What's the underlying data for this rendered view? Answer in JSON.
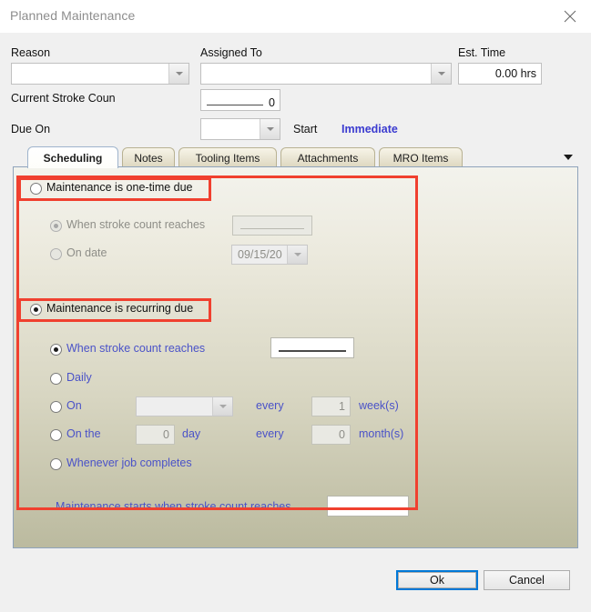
{
  "window": {
    "title": "Planned Maintenance",
    "close_icon": "close-icon"
  },
  "form": {
    "reason_label": "Reason",
    "reason_value": "",
    "assigned_to_label": "Assigned To",
    "assigned_to_value": "",
    "est_time_label": "Est. Time",
    "est_time_value": "0.00 hrs",
    "current_stroke_count_label": "Current Stroke Coun",
    "current_stroke_count_value": "0",
    "due_on_label": "Due On",
    "due_on_value": "",
    "start_label": "Start",
    "start_value": "Immediate"
  },
  "tabs": [
    {
      "label": "Scheduling",
      "active": true
    },
    {
      "label": "Notes",
      "active": false
    },
    {
      "label": "Tooling Items",
      "active": false
    },
    {
      "label": "Attachments",
      "active": false
    },
    {
      "label": "MRO Items",
      "active": false
    }
  ],
  "tab_overflow_icon": "chevron-down-icon",
  "scheduling": {
    "one_time": {
      "label": "Maintenance is one-time due",
      "selected": false,
      "options": [
        {
          "label": "When stroke count reaches",
          "selected": true,
          "disabled": true,
          "value": ""
        },
        {
          "label": "On date",
          "selected": false,
          "disabled": true,
          "value": "09/15/20"
        }
      ]
    },
    "recurring": {
      "label": "Maintenance is recurring due",
      "selected": true,
      "options": [
        {
          "label": "When stroke count reaches",
          "selected": true,
          "value": ""
        },
        {
          "label": "Daily",
          "selected": false
        },
        {
          "label": "On",
          "selected": false
        },
        {
          "label": "On the",
          "selected": false
        },
        {
          "label": "Whenever job completes",
          "selected": false
        }
      ],
      "on_row": {
        "dropdown_value": "",
        "every_label": "every",
        "interval_value": "1",
        "unit_label": "week(s)"
      },
      "on_the_row": {
        "day_value": "0",
        "day_label": "day",
        "every_label": "every",
        "interval_value": "0",
        "unit_label": "month(s)"
      },
      "start_note_label": "Maintenance starts when stroke count reaches",
      "start_note_value": ""
    }
  },
  "footer": {
    "ok_label": "Ok",
    "cancel_label": "Cancel"
  },
  "colors": {
    "annotation": "#f0402f",
    "link": "#3b3bd0",
    "recurring_text": "#4a52c8",
    "focus": "#0078d7"
  }
}
